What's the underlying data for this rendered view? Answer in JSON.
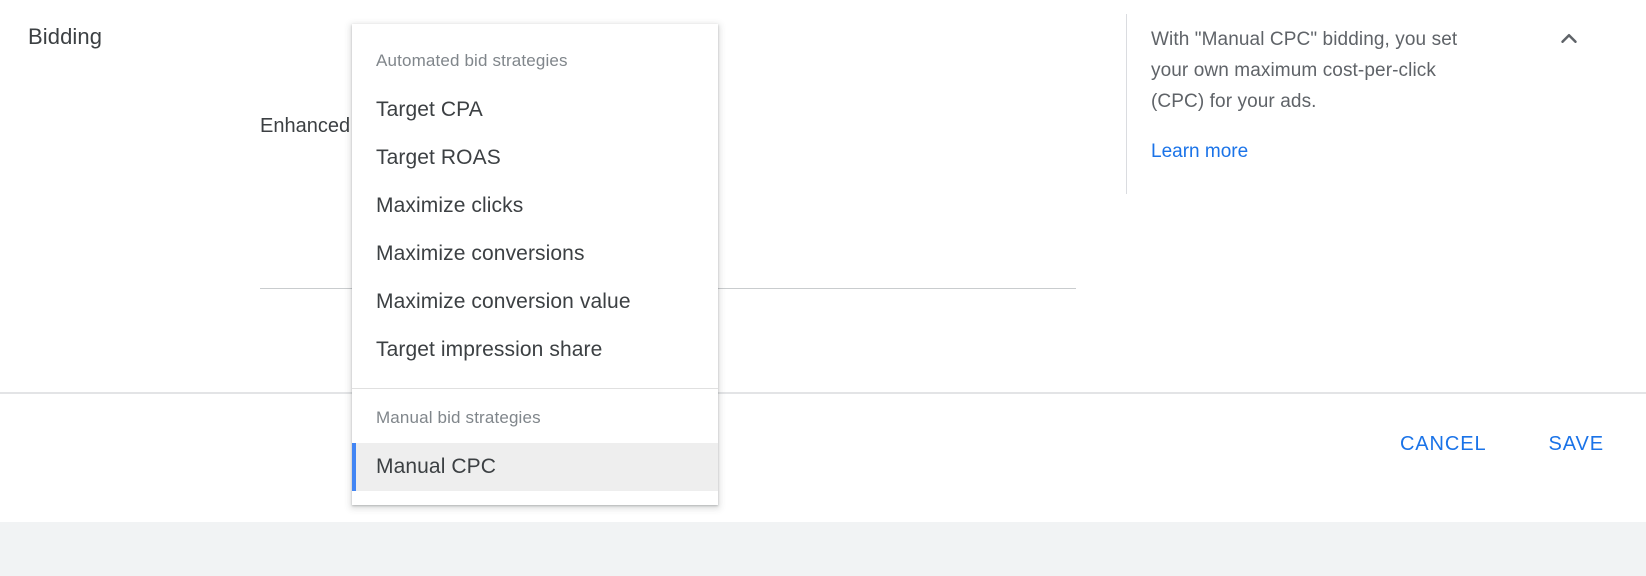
{
  "section": {
    "title": "Bidding"
  },
  "field": {
    "bid_strategy_value": "Enhanced CPC",
    "help_icon": "help-circle-icon"
  },
  "dropdown": {
    "groups": [
      {
        "label": "Automated bid strategies",
        "items": [
          {
            "label": "Target CPA",
            "selected": false
          },
          {
            "label": "Target ROAS",
            "selected": false
          },
          {
            "label": "Maximize clicks",
            "selected": false
          },
          {
            "label": "Maximize conversions",
            "selected": false
          },
          {
            "label": "Maximize conversion value",
            "selected": false
          },
          {
            "label": "Target impression share",
            "selected": false
          }
        ]
      },
      {
        "label": "Manual bid strategies",
        "items": [
          {
            "label": "Manual CPC",
            "selected": true
          }
        ]
      }
    ]
  },
  "info_panel": {
    "text": "With \"Manual CPC\" bidding, you set your own maximum cost-per-click (CPC) for your ads.",
    "learn_more_label": "Learn more",
    "collapse_icon": "chevron-up-icon"
  },
  "footer": {
    "cancel_label": "CANCEL",
    "save_label": "SAVE"
  },
  "colors": {
    "accent_blue": "#1a73e8",
    "selected_bar": "#4285f4",
    "selected_bg": "#eeeeee",
    "text_primary": "#3c4043",
    "text_secondary": "#5f6368",
    "page_background": "#f1f3f4"
  }
}
